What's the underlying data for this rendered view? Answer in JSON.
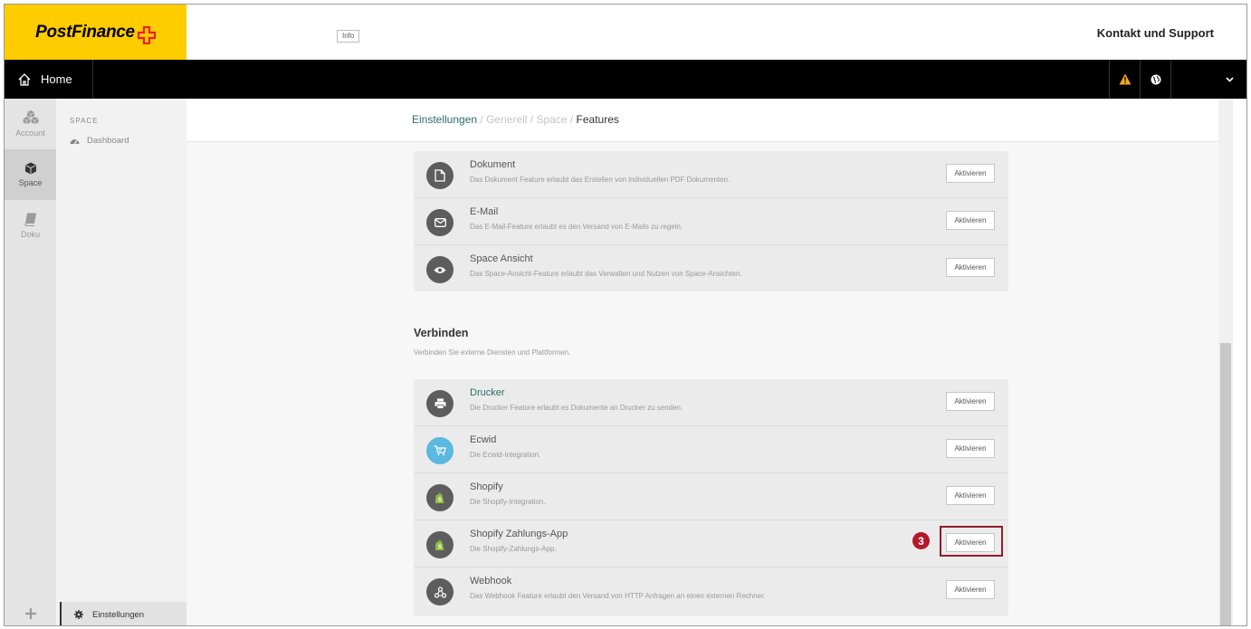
{
  "brand": {
    "logo_text": "PostFinance",
    "accent": "#ffcc00",
    "cross_color": "#e5202d"
  },
  "header": {
    "info_label": "Info",
    "support_label": "Kontakt und Support"
  },
  "nav": {
    "home_label": "Home",
    "warning_icon": "warning-icon",
    "globe_icon": "globe-icon",
    "user_menu_icon": "chevron-down-icon"
  },
  "rail": {
    "items": [
      {
        "label": "Account",
        "icon": "cubes-icon"
      },
      {
        "label": "Space",
        "icon": "cube-icon"
      },
      {
        "label": "Doku",
        "icon": "book-icon"
      }
    ],
    "add_icon": "plus-icon"
  },
  "subnav": {
    "section_title": "SPACE",
    "dashboard_label": "Dashboard",
    "settings_label": "Einstellungen"
  },
  "breadcrumb": {
    "root": "Einstellungen",
    "level2": "Generell",
    "level3": "Space",
    "current": "Features",
    "separator": "/"
  },
  "features_top": [
    {
      "title": "Dokument",
      "description": "Das Dokument Feature erlaubt das Erstellen von individuellen PDF Dokumenten.",
      "button": "Aktivieren",
      "icon": "document-icon"
    },
    {
      "title": "E-Mail",
      "description": "Das E-Mail-Feature erlaubt es den Versand von E-Mails zu regeln.",
      "button": "Aktivieren",
      "icon": "envelope-icon"
    },
    {
      "title": "Space Ansicht",
      "description": "Das Space-Ansicht-Feature erlaubt das Verwalten und Nutzen von Space-Ansichten.",
      "button": "Aktivieren",
      "icon": "eye-icon"
    }
  ],
  "connect_section": {
    "title": "Verbinden",
    "subtitle": "Verbinden Sie externe Diensten und Plattformen."
  },
  "features_connect": [
    {
      "title": "Drucker",
      "description": "Die Drucker Feature erlaubt es Dokumente an Drucker zu senden.",
      "button": "Aktivieren",
      "icon": "printer-icon"
    },
    {
      "title": "Ecwid",
      "description": "Die Ecwid-Integration.",
      "button": "Aktivieren",
      "icon": "cart-icon"
    },
    {
      "title": "Shopify",
      "description": "Die Shopify-Integration.",
      "button": "Aktivieren",
      "icon": "shopify-bag-icon"
    },
    {
      "title": "Shopify Zahlungs-App",
      "description": "Die Shopify-Zahlungs-App.",
      "button": "Aktivieren",
      "icon": "shopify-bag-icon"
    },
    {
      "title": "Webhook",
      "description": "Das Webhook Feature erlaubt den Versand von HTTP Anfragen an einen externen Rechner.",
      "button": "Aktivieren",
      "icon": "webhook-icon"
    }
  ],
  "annotation": {
    "step_number": "3",
    "color": "#8c1d2b"
  }
}
